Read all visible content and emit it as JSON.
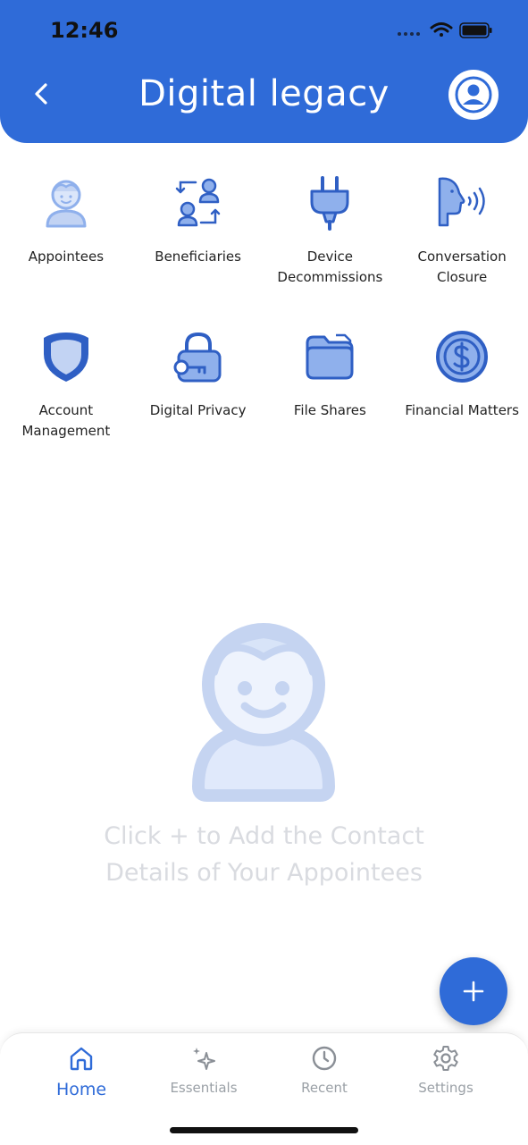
{
  "status_bar": {
    "time": "12:46"
  },
  "header": {
    "title": "Digital legacy",
    "back_icon": "chevron-left-icon",
    "profile_icon": "user-circle-icon"
  },
  "categories": [
    {
      "label": "Appointees",
      "icon": "appointee-icon"
    },
    {
      "label": "Beneficiaries",
      "icon": "beneficiaries-icon"
    },
    {
      "label": "Device Decommissions",
      "icon": "plug-icon"
    },
    {
      "label": "Conversation Closure",
      "icon": "speaking-head-icon"
    },
    {
      "label": "Account Management",
      "icon": "shield-icon"
    },
    {
      "label": "Digital Privacy",
      "icon": "lock-key-icon"
    },
    {
      "label": "File Shares",
      "icon": "folder-icon"
    },
    {
      "label": "Financial Matters",
      "icon": "dollar-coin-icon"
    }
  ],
  "empty_state": {
    "message": "Click + to Add the Contact Details of Your Appointees",
    "icon": "appointee-icon"
  },
  "fab": {
    "icon": "plus-icon"
  },
  "tabs": [
    {
      "label": "Home",
      "icon": "home-icon",
      "active": true
    },
    {
      "label": "Essentials",
      "icon": "sparkle-icon",
      "active": false
    },
    {
      "label": "Recent",
      "icon": "clock-icon",
      "active": false
    },
    {
      "label": "Settings",
      "icon": "gear-icon",
      "active": false
    }
  ],
  "colors": {
    "primary": "#2f6bd8",
    "icon_fill_light": "#8fb0ec",
    "empty_illustration": "#c5d4f1",
    "empty_text": "#d9dbe0",
    "tab_inactive": "#9aa0a6"
  }
}
